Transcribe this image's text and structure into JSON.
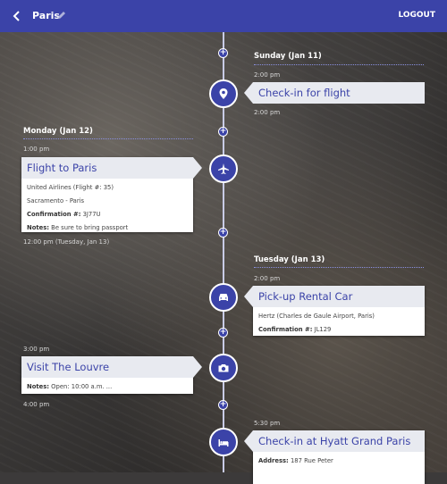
{
  "header": {
    "title": "Paris",
    "logout_label": "LOGOUT"
  },
  "days": {
    "sun": "Sunday (Jan 11)",
    "mon": "Monday (Jan 12)",
    "tue": "Tuesday (Jan 13)"
  },
  "events": {
    "checkin_flight": {
      "time_start": "2:00 pm",
      "title": "Check-in for flight",
      "time_end": "2:00 pm",
      "icon": "map-pin-icon"
    },
    "flight": {
      "time_start": "1:00 pm",
      "title": "Flight to Paris",
      "airline": "United Airlines (Flight #: 35)",
      "route": "Sacramento - Paris",
      "confirmation_label": "Confirmation #:",
      "confirmation_value": "3J77U",
      "notes_label": "Notes:",
      "notes_value": "Be sure to bring passport",
      "time_end": "12:00 pm (Tuesday, Jan 13)",
      "icon": "airplane-icon"
    },
    "rental": {
      "time_start": "2:00 pm",
      "title": "Pick-up Rental Car",
      "company": "Hertz (Charles de Gaule Airport, Paris)",
      "confirmation_label": "Confirmation #:",
      "confirmation_value": "JL129",
      "icon": "car-icon"
    },
    "louvre": {
      "time_start": "3:00 pm",
      "title": "Visit The Louvre",
      "notes_label": "Notes:",
      "notes_value": "Open: 10:00 a.m. ...",
      "time_end": "4:00 pm",
      "icon": "camera-icon"
    },
    "hotel": {
      "time_start": "5:30 pm",
      "title": "Check-in at Hyatt Grand Paris",
      "address_label": "Address:",
      "address_value": "187 Rue Peter",
      "icon": "bed-icon"
    }
  },
  "colors": {
    "primary": "#3b43a8",
    "card_title_bg": "#e8eaf0"
  }
}
